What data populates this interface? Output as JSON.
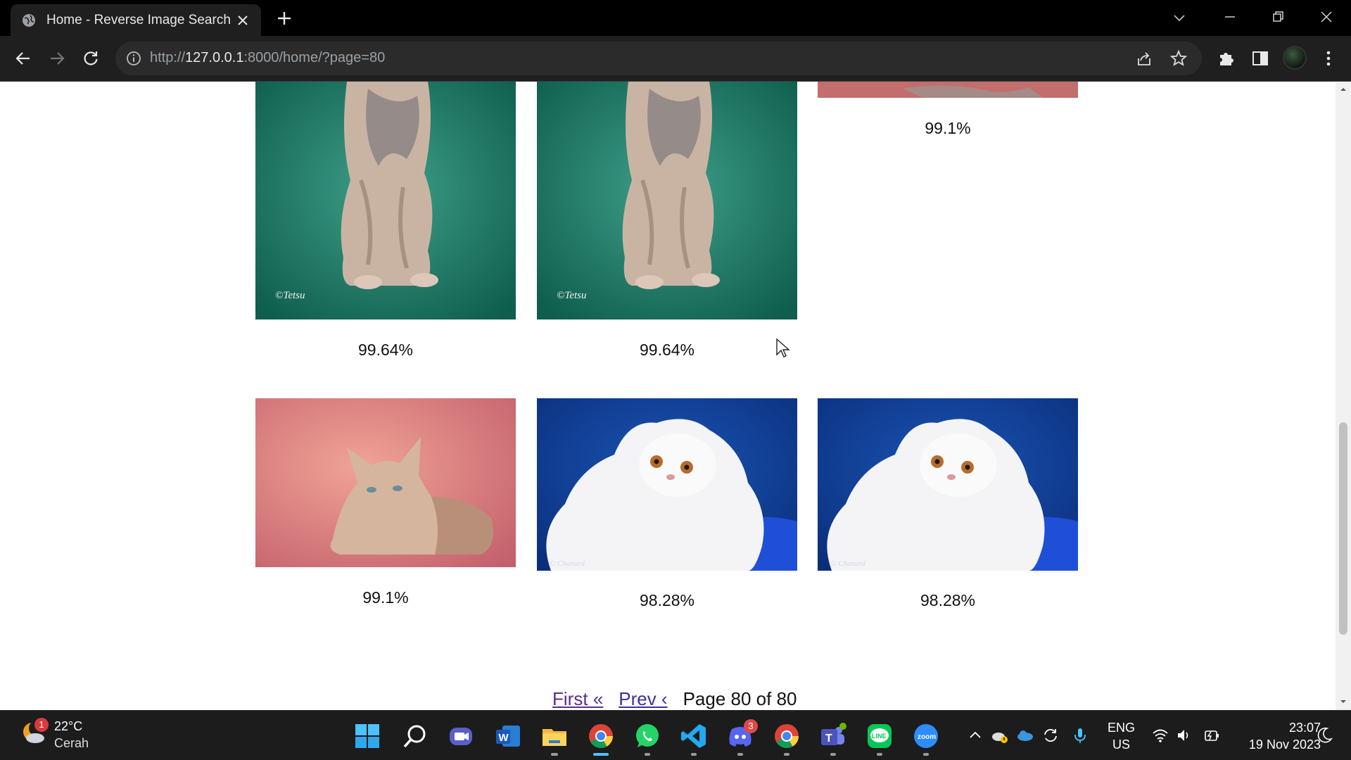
{
  "browser": {
    "tab_title": "Home - Reverse Image Search",
    "url_scheme": "http://",
    "url_host": "127.0.0.1",
    "url_rest": ":8000/home/?page=80"
  },
  "results": [
    {
      "id": "r1",
      "score": "99.64%",
      "watermark": "©Tetsu"
    },
    {
      "id": "r2",
      "score": "99.64%",
      "watermark": "©Tetsu"
    },
    {
      "id": "r3",
      "score": "99.1%"
    },
    {
      "id": "r4",
      "score": "99.1%"
    },
    {
      "id": "r5",
      "score": "98.28%"
    },
    {
      "id": "r6",
      "score": "98.28%"
    }
  ],
  "pagination": {
    "first_label": "First «",
    "prev_label": "Prev ‹",
    "status": "Page 80 of 80"
  },
  "taskbar": {
    "weather_badge": "1",
    "temperature": "22°C",
    "condition": "Cerah",
    "discord_badge": "3",
    "lang_primary": "ENG",
    "lang_secondary": "US",
    "time": "23:07",
    "date": "19 Nov 2023"
  }
}
